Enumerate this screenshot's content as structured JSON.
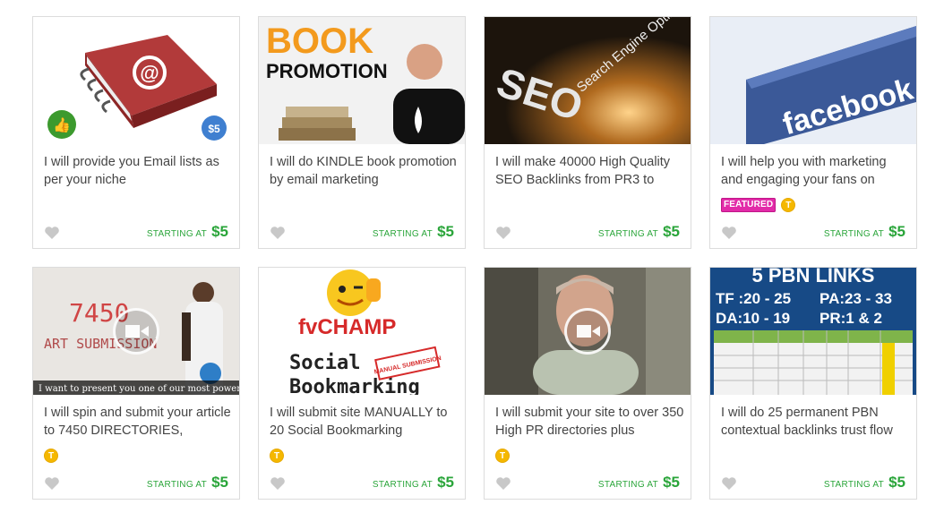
{
  "currency_price_label": "STARTING AT",
  "gigs": [
    {
      "title": "I will provide you Email lists as per your niche",
      "starting": "STARTING AT",
      "price": "$5",
      "thumb_text": "$5"
    },
    {
      "title": "I will do KINDLE book promotion by email marketing",
      "starting": "STARTING AT",
      "price": "$5",
      "thumb_line1": "BOOK",
      "thumb_line2": "PROMOTION"
    },
    {
      "title": "I will make 40000 High Quality SEO Backlinks from PR3 to",
      "starting": "STARTING AT",
      "price": "$5",
      "thumb_big": "SEO",
      "thumb_arc": "Search Engine Optimization"
    },
    {
      "title": "I will help you with marketing and engaging your fans on",
      "starting": "STARTING AT",
      "price": "$5",
      "featured": "FEATURED",
      "level": "T",
      "thumb_logo": "facebook"
    },
    {
      "title": "I will spin and submit your article to 7450 DIRECTORIES,",
      "starting": "STARTING AT",
      "price": "$5",
      "level": "T",
      "thumb_num": "7450",
      "thumb_word": "ART SUBMISSION",
      "thumb_caption": "I want to present you one of our most powerful gigs"
    },
    {
      "title": "I will submit site MANUALLY to 20 Social Bookmarking",
      "starting": "STARTING AT",
      "price": "$5",
      "level": "T",
      "thumb_brand": "fvCHAMP",
      "thumb_l1": "Social",
      "thumb_l2": "Bookmarking",
      "thumb_stamp": "MANUAL SUBMISSION"
    },
    {
      "title": "I will submit your site to over 350 High PR directories plus",
      "starting": "STARTING AT",
      "price": "$5",
      "level": "T"
    },
    {
      "title": "I will do 25 permanent PBN contextual backlinks trust flow",
      "starting": "STARTING AT",
      "price": "$5",
      "thumb_head": "5 PBN LINKS",
      "thumb_tf": "TF :20 - 25",
      "thumb_pa": "PA:23 - 33",
      "thumb_da": "DA:10 - 19",
      "thumb_pr": "PR:1 & 2"
    }
  ],
  "colors": {
    "price_green": "#2aa53a",
    "featured_pink": "#e22ba8",
    "level_gold": "#f5b800"
  }
}
